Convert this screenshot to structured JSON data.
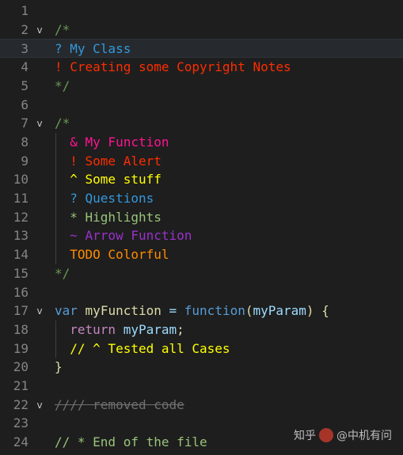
{
  "colors": {
    "background": "#1e1e1e",
    "line_number": "#858585",
    "comment_green": "#6a9955",
    "question_blue": "#3498db",
    "alert_red": "#ff2d00",
    "function_pink": "#ff1493",
    "stuff_yellow": "#ffff00",
    "highlight_green": "#98c379",
    "arrow_purple": "#9932cc",
    "todo_orange": "#ff8c00",
    "keyword_blue": "#569cd6",
    "control_purple": "#c586c0",
    "identifier_yellow": "#dcdcaa",
    "param_blue": "#9cdcfe",
    "strike_gray": "#6f6f6f"
  },
  "lines": [
    {
      "n": "1",
      "fold": false,
      "tokens": []
    },
    {
      "n": "2",
      "fold": true,
      "tokens": [
        {
          "t": "/*",
          "c": "comment_green"
        }
      ]
    },
    {
      "n": "3",
      "fold": false,
      "current": true,
      "tokens": [
        {
          "t": "? My Class",
          "c": "question_blue"
        }
      ]
    },
    {
      "n": "4",
      "fold": false,
      "tokens": [
        {
          "t": "! Creating some Copyright Notes",
          "c": "alert_red"
        }
      ]
    },
    {
      "n": "5",
      "fold": false,
      "tokens": [
        {
          "t": "*/",
          "c": "comment_green"
        }
      ]
    },
    {
      "n": "6",
      "fold": false,
      "tokens": []
    },
    {
      "n": "7",
      "fold": true,
      "tokens": [
        {
          "t": "/*",
          "c": "comment_green"
        }
      ]
    },
    {
      "n": "8",
      "fold": false,
      "tokens": [
        {
          "t": "  & My Function",
          "c": "function_pink"
        }
      ]
    },
    {
      "n": "9",
      "fold": false,
      "tokens": [
        {
          "t": "  ! Some Alert",
          "c": "alert_red"
        }
      ]
    },
    {
      "n": "10",
      "fold": false,
      "tokens": [
        {
          "t": "  ^ Some stuff",
          "c": "stuff_yellow"
        }
      ]
    },
    {
      "n": "11",
      "fold": false,
      "tokens": [
        {
          "t": "  ? Questions",
          "c": "question_blue"
        }
      ]
    },
    {
      "n": "12",
      "fold": false,
      "tokens": [
        {
          "t": "  * Highlights",
          "c": "highlight_green"
        }
      ]
    },
    {
      "n": "13",
      "fold": false,
      "tokens": [
        {
          "t": "  ~ Arrow Function",
          "c": "arrow_purple"
        }
      ]
    },
    {
      "n": "14",
      "fold": false,
      "tokens": [
        {
          "t": "  TODO Colorful",
          "c": "todo_orange"
        }
      ]
    },
    {
      "n": "15",
      "fold": false,
      "tokens": [
        {
          "t": "*/",
          "c": "comment_green"
        }
      ]
    },
    {
      "n": "16",
      "fold": false,
      "tokens": []
    },
    {
      "n": "17",
      "fold": true,
      "tokens": [
        {
          "t": "var",
          "c": "keyword_blue"
        },
        {
          "t": " ",
          "c": "identifier_yellow"
        },
        {
          "t": "myFunction",
          "c": "identifier_yellow"
        },
        {
          "t": " = ",
          "c": "param_blue"
        },
        {
          "t": "function",
          "c": "keyword_blue"
        },
        {
          "t": "(",
          "c": "identifier_yellow"
        },
        {
          "t": "myParam",
          "c": "param_blue"
        },
        {
          "t": ") {",
          "c": "identifier_yellow"
        }
      ]
    },
    {
      "n": "18",
      "fold": false,
      "tokens": [
        {
          "t": "  return",
          "c": "control_purple"
        },
        {
          "t": " ",
          "c": "identifier_yellow"
        },
        {
          "t": "myParam",
          "c": "param_blue"
        },
        {
          "t": ";",
          "c": "identifier_yellow"
        }
      ]
    },
    {
      "n": "19",
      "fold": false,
      "tokens": [
        {
          "t": "  // ^ Tested all Cases",
          "c": "stuff_yellow"
        }
      ]
    },
    {
      "n": "20",
      "fold": false,
      "tokens": [
        {
          "t": "}",
          "c": "identifier_yellow"
        }
      ]
    },
    {
      "n": "21",
      "fold": false,
      "tokens": []
    },
    {
      "n": "22",
      "fold": true,
      "tokens": [
        {
          "t": "//// removed code",
          "c": "strike_gray",
          "strike": true
        }
      ]
    },
    {
      "n": "23",
      "fold": false,
      "tokens": []
    },
    {
      "n": "24",
      "fold": false,
      "tokens": [
        {
          "t": "// * End of the file",
          "c": "highlight_green"
        }
      ]
    }
  ],
  "watermark": {
    "text_left": "知乎",
    "text_right": "@中机有问"
  }
}
